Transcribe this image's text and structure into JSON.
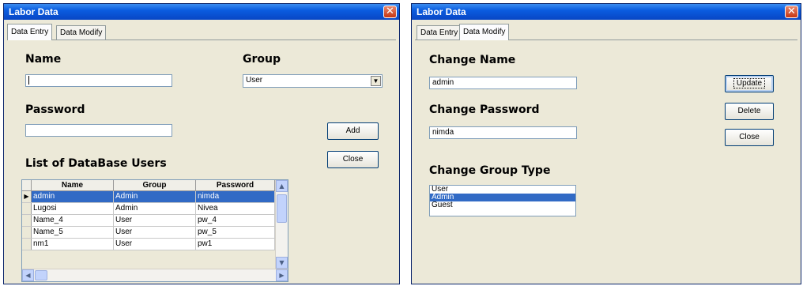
{
  "left_window": {
    "title": "Labor Data",
    "close_glyph": "✕",
    "tabs": [
      {
        "label": "Data Entry",
        "active": true
      },
      {
        "label": "Data Modify",
        "active": false
      }
    ],
    "name_label": "Name",
    "name_value": "",
    "group_label": "Group",
    "group_value": "User",
    "password_label": "Password",
    "password_value": "",
    "add_button": "Add",
    "close_button": "Close",
    "list_heading": "List of DataBase Users",
    "grid": {
      "columns": [
        "Name",
        "Group",
        "Password"
      ],
      "rows": [
        {
          "name": "admin",
          "group": "Admin",
          "password": "nimda",
          "selected": true
        },
        {
          "name": "Lugosi",
          "group": "Admin",
          "password": "Nivea",
          "selected": false
        },
        {
          "name": "Name_4",
          "group": "User",
          "password": "pw_4",
          "selected": false
        },
        {
          "name": "Name_5",
          "group": "User",
          "password": "pw_5",
          "selected": false
        },
        {
          "name": "nm1",
          "group": "User",
          "password": "pw1",
          "selected": false
        }
      ],
      "row_indicator": "▶",
      "scroll_up": "▲",
      "scroll_down": "▼",
      "scroll_left": "◀",
      "scroll_right": "▶"
    }
  },
  "right_window": {
    "title": "Labor Data",
    "close_glyph": "✕",
    "tabs": [
      {
        "label": "Data Entry",
        "active": false
      },
      {
        "label": "Data Modify",
        "active": true
      }
    ],
    "change_name_label": "Change Name",
    "change_name_value": "admin",
    "change_password_label": "Change Password",
    "change_password_value": "nimda",
    "change_group_label": "Change Group Type",
    "group_options": [
      {
        "label": "User",
        "selected": false
      },
      {
        "label": "Admin",
        "selected": true
      },
      {
        "label": "Guest",
        "selected": false
      }
    ],
    "update_button": "Update",
    "delete_button": "Delete",
    "close_button": "Close"
  },
  "colors": {
    "title_bar": "#0a5ce0",
    "dialog_bg": "#ece9d8",
    "selection": "#316ac5",
    "close_button": "#c63512"
  }
}
